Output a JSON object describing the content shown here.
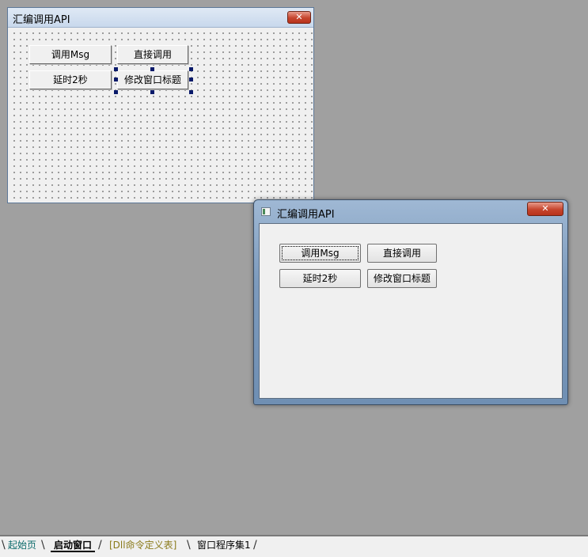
{
  "design_form": {
    "title": "汇编调用API",
    "close_symbol": "✕",
    "buttons": [
      {
        "label": "调用Msg"
      },
      {
        "label": "直接调用"
      },
      {
        "label": "延时2秒"
      },
      {
        "label": "修改窗口标题"
      }
    ]
  },
  "run_window": {
    "title": "汇编调用API",
    "close_symbol": "✕",
    "buttons": [
      {
        "label": "调用Msg"
      },
      {
        "label": "直接调用"
      },
      {
        "label": "延时2秒"
      },
      {
        "label": "修改窗口标题"
      }
    ]
  },
  "tabs": [
    {
      "label": "起始页",
      "color": "#0a6a6a"
    },
    {
      "label": "启动窗口",
      "color": "#000000",
      "active": true
    },
    {
      "label": "[Dll命令定义表]",
      "color": "#8a7a1a"
    },
    {
      "label": "窗口程序集1",
      "color": "#000000"
    }
  ],
  "colors": {
    "workspace": "#a0a0a0",
    "close_button": "#c6452d",
    "selection_handle": "#0a1a6a"
  }
}
